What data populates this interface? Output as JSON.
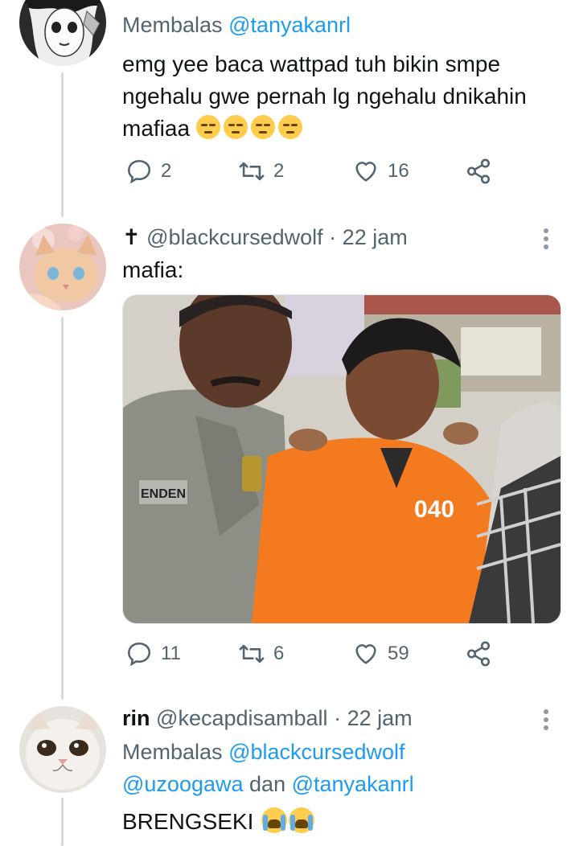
{
  "tweets": [
    {
      "reply_prefix": "Membalas",
      "reply_handle": "@tanyakanrl",
      "text": "emg yee baca wattpad tuh bikin smpe ngehalu gwe pernah lg ngehalu dnikahin mafiaa",
      "emoji": "pensive-face x4",
      "counts": {
        "reply": "2",
        "retweet": "2",
        "like": "16"
      }
    },
    {
      "name_symbol": "✝",
      "handle": "@blackcursedwolf",
      "separator": "·",
      "time": "22 jam",
      "text": "mafia:",
      "image_text": {
        "badge": "040",
        "nameplate": "ENDEN"
      },
      "counts": {
        "reply": "11",
        "retweet": "6",
        "like": "59"
      }
    },
    {
      "name": "rin",
      "handle": "@kecapdisamball",
      "separator": "·",
      "time": "22 jam",
      "reply_prefix": "Membalas",
      "reply_handle_1": "@blackcursedwolf",
      "reply_handle_2": "@uzoogawa",
      "reply_and": "dan",
      "reply_handle_3": "@tanyakanrl",
      "text": "BRENGSEKI",
      "emoji": "loudly-crying-face x2"
    }
  ],
  "colors": {
    "text": "#0f1419",
    "muted": "#536471",
    "link": "#1d9bf0",
    "thread": "#cfd9de",
    "prison_orange": "#f47a1f",
    "police_uniform": "#8d8f86"
  }
}
